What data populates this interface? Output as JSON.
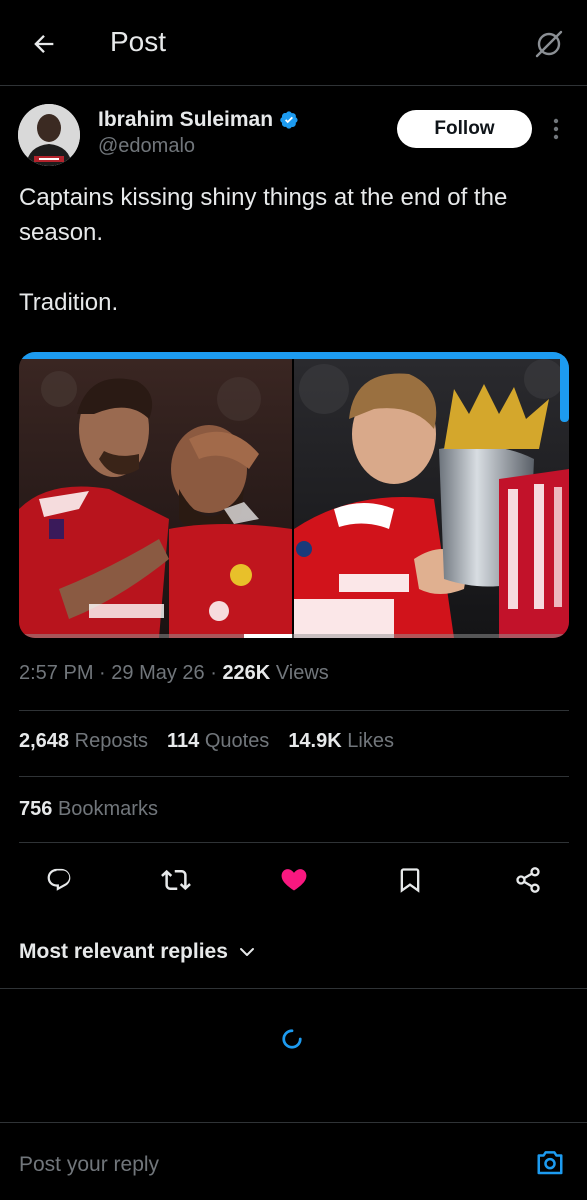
{
  "header": {
    "title": "Post",
    "back_icon": "arrow-left-icon",
    "grok_icon": "grok-icon"
  },
  "author": {
    "name": "Ibrahim Suleiman",
    "handle": "@edomalo",
    "verified": true,
    "follow_label": "Follow"
  },
  "post": {
    "text_lines": [
      "Captains kissing shiny things at the end of the season.",
      "Tradition."
    ],
    "media": [
      {
        "alt": "Manchester United captain kissing teammate's head"
      },
      {
        "alt": "Arsenal captain kissing Premier League trophy"
      }
    ],
    "time": "2:57 PM",
    "date": "29 May 26",
    "views_count": "226K",
    "views_label": "Views"
  },
  "stats": {
    "reposts_count": "2,648",
    "reposts_label": "Reposts",
    "quotes_count": "114",
    "quotes_label": "Quotes",
    "likes_count": "14.9K",
    "likes_label": "Likes",
    "bookmarks_count": "756",
    "bookmarks_label": "Bookmarks"
  },
  "actions": {
    "reply_icon": "reply-icon",
    "repost_icon": "repost-icon",
    "like_icon": "heart-icon",
    "like_color": "#f91880",
    "bookmark_icon": "bookmark-icon",
    "share_icon": "share-icon"
  },
  "replies": {
    "sort_label": "Most relevant replies"
  },
  "reply_bar": {
    "placeholder": "Post your reply"
  },
  "colors": {
    "background": "#000000",
    "accent": "#1d9bf0",
    "text": "#e7e9ea",
    "muted": "#71767b"
  }
}
